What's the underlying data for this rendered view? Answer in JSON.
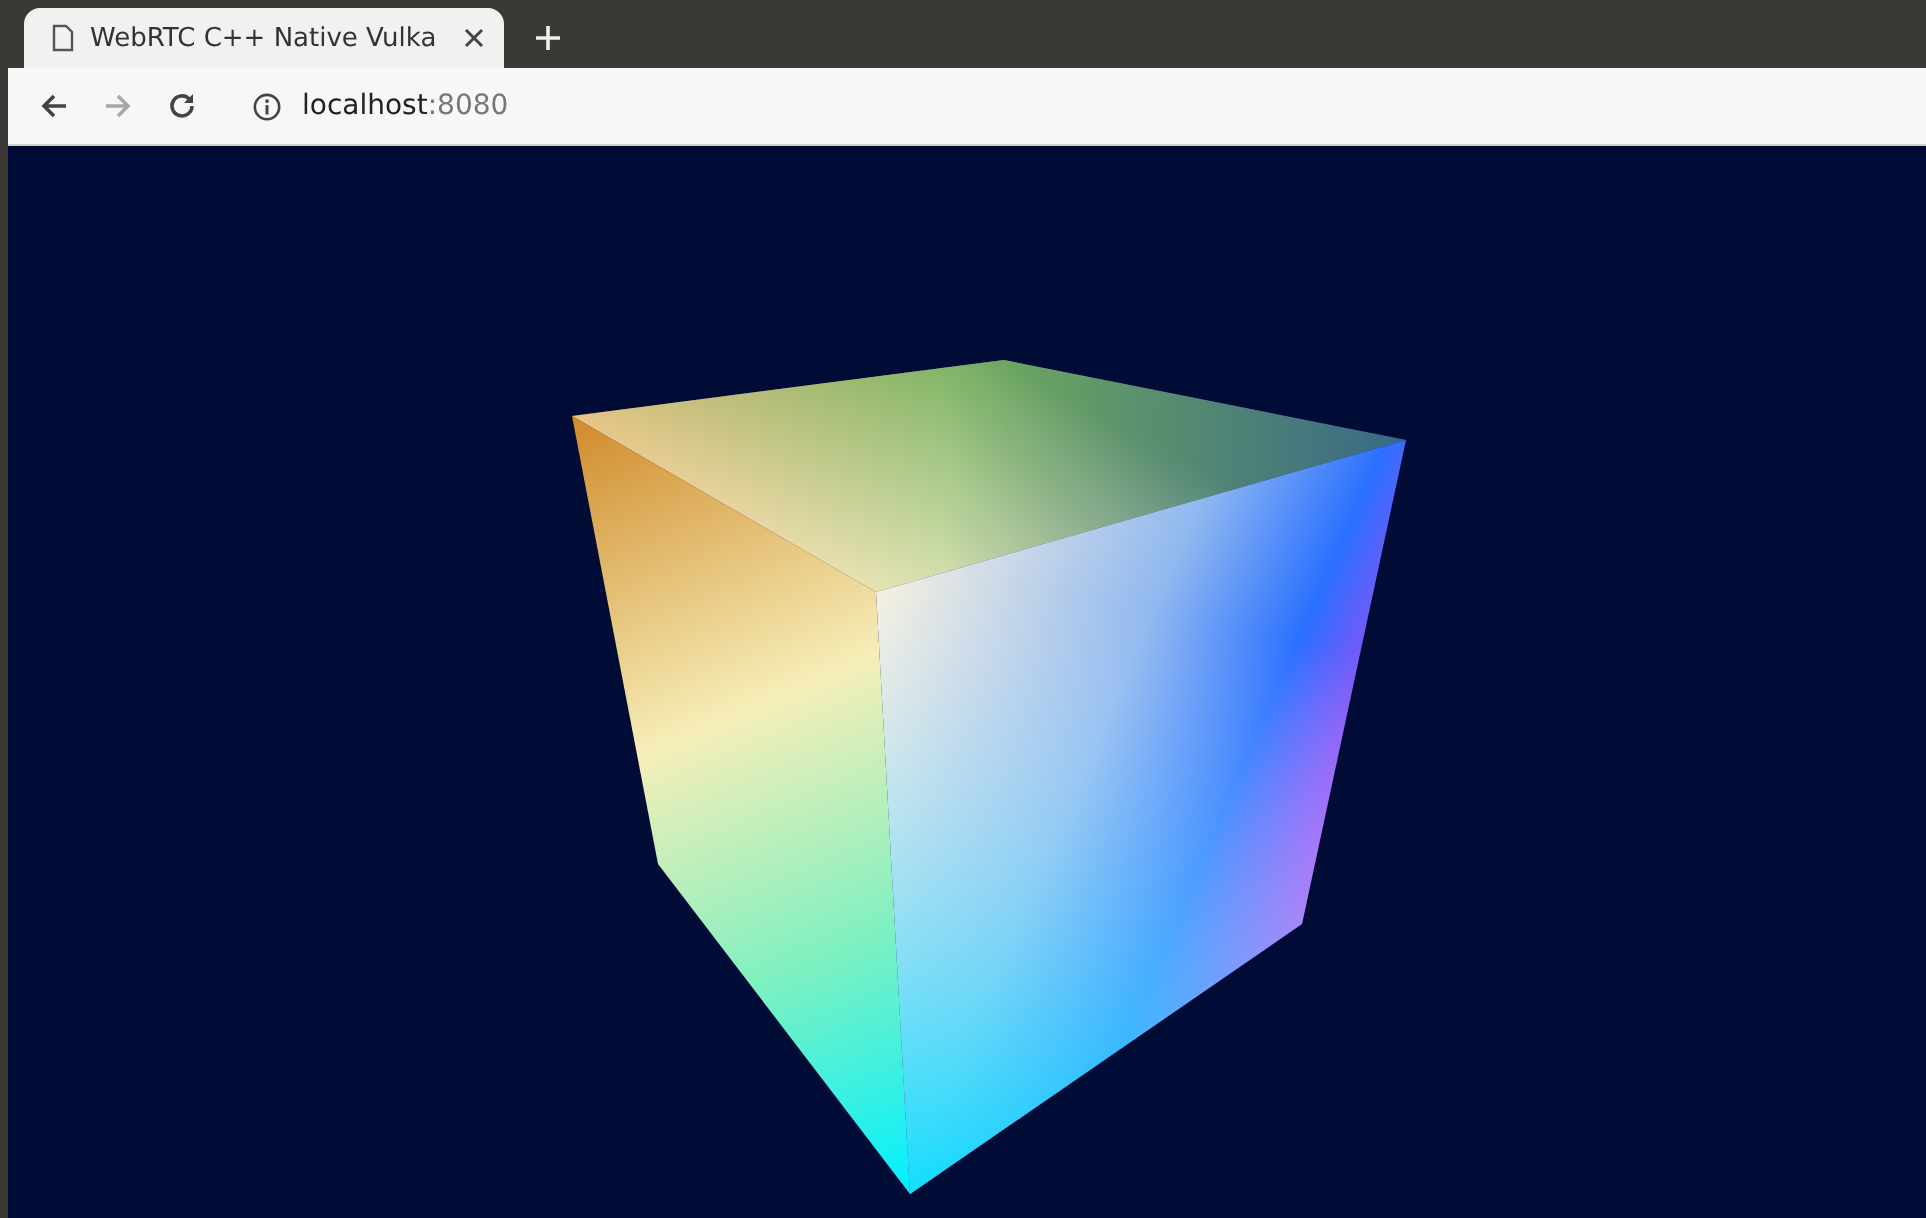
{
  "tabs": [
    {
      "title": "WebRTC C++ Native Vulka",
      "selected": true
    }
  ],
  "toolbar": {
    "nav": [
      {
        "kind": "back",
        "disabled": false
      },
      {
        "kind": "forward",
        "disabled": true
      },
      {
        "kind": "reload",
        "disabled": false
      }
    ],
    "address": {
      "host": "localhost",
      "port": ":8080"
    }
  }
}
